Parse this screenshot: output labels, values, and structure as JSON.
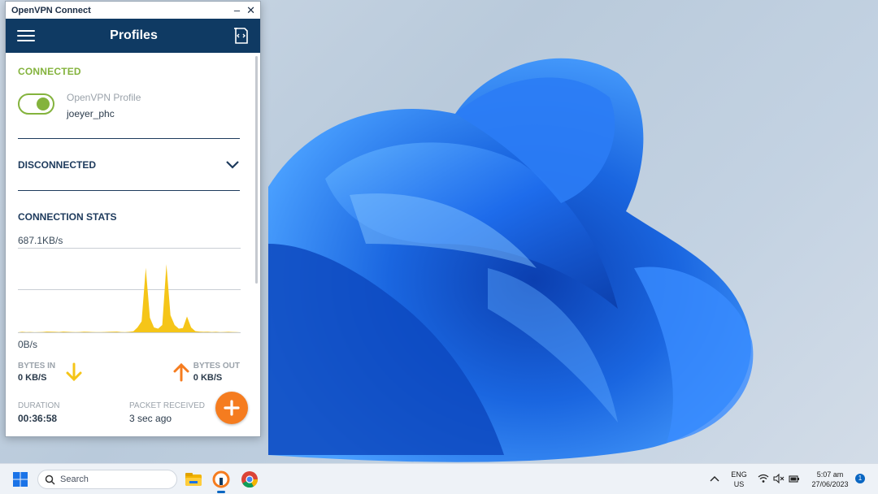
{
  "window": {
    "app_title": "OpenVPN Connect",
    "header_title": "Profiles"
  },
  "connected": {
    "section_label": "CONNECTED",
    "profile_name": "OpenVPN Profile",
    "profile_user": "joeyer_phc",
    "toggle_on": true
  },
  "disconnected": {
    "section_label": "DISCONNECTED"
  },
  "stats": {
    "section_label": "CONNECTION STATS",
    "max_speed": "687.1KB/s",
    "min_speed": "0B/s",
    "bytes_in_label": "BYTES IN",
    "bytes_in_value": "0 KB/S",
    "bytes_out_label": "BYTES OUT",
    "bytes_out_value": "0 KB/S",
    "duration_label": "DURATION",
    "duration_value": "00:36:58",
    "packet_label": "PACKET RECEIVED",
    "packet_value": "3 sec ago"
  },
  "chart_data": {
    "type": "area",
    "ylim": [
      0,
      687.1
    ],
    "series": [
      {
        "values": [
          0,
          4,
          2,
          3,
          1,
          2,
          3,
          6,
          5,
          4,
          3,
          6,
          4,
          3,
          2,
          3,
          5,
          4,
          3,
          2,
          2,
          3,
          4,
          5,
          6,
          3,
          2,
          4,
          8,
          40,
          90,
          530,
          120,
          40,
          30,
          60,
          560,
          140,
          60,
          30,
          35,
          130,
          40,
          10,
          6,
          4,
          5,
          3,
          4,
          2,
          3,
          4,
          3,
          2,
          0
        ]
      }
    ]
  },
  "taskbar": {
    "search_placeholder": "Search",
    "lang_top": "ENG",
    "lang_bottom": "US",
    "time": "5:07 am",
    "date": "27/06/2023",
    "notification_count": "1"
  },
  "colors": {
    "header_bg": "#0f3a63",
    "connected_green": "#84b33d",
    "chart_yellow": "#f5c518",
    "bytes_in_arrow": "#f5c518",
    "bytes_out_arrow": "#f57c1f",
    "fab_orange": "#f57c1f"
  },
  "icons": {
    "menu": "hamburger-icon",
    "import": "import-profile-icon",
    "expand": "chevron-down-icon",
    "bytes_in": "arrow-down-icon",
    "bytes_out": "arrow-up-icon",
    "add": "plus-icon"
  }
}
